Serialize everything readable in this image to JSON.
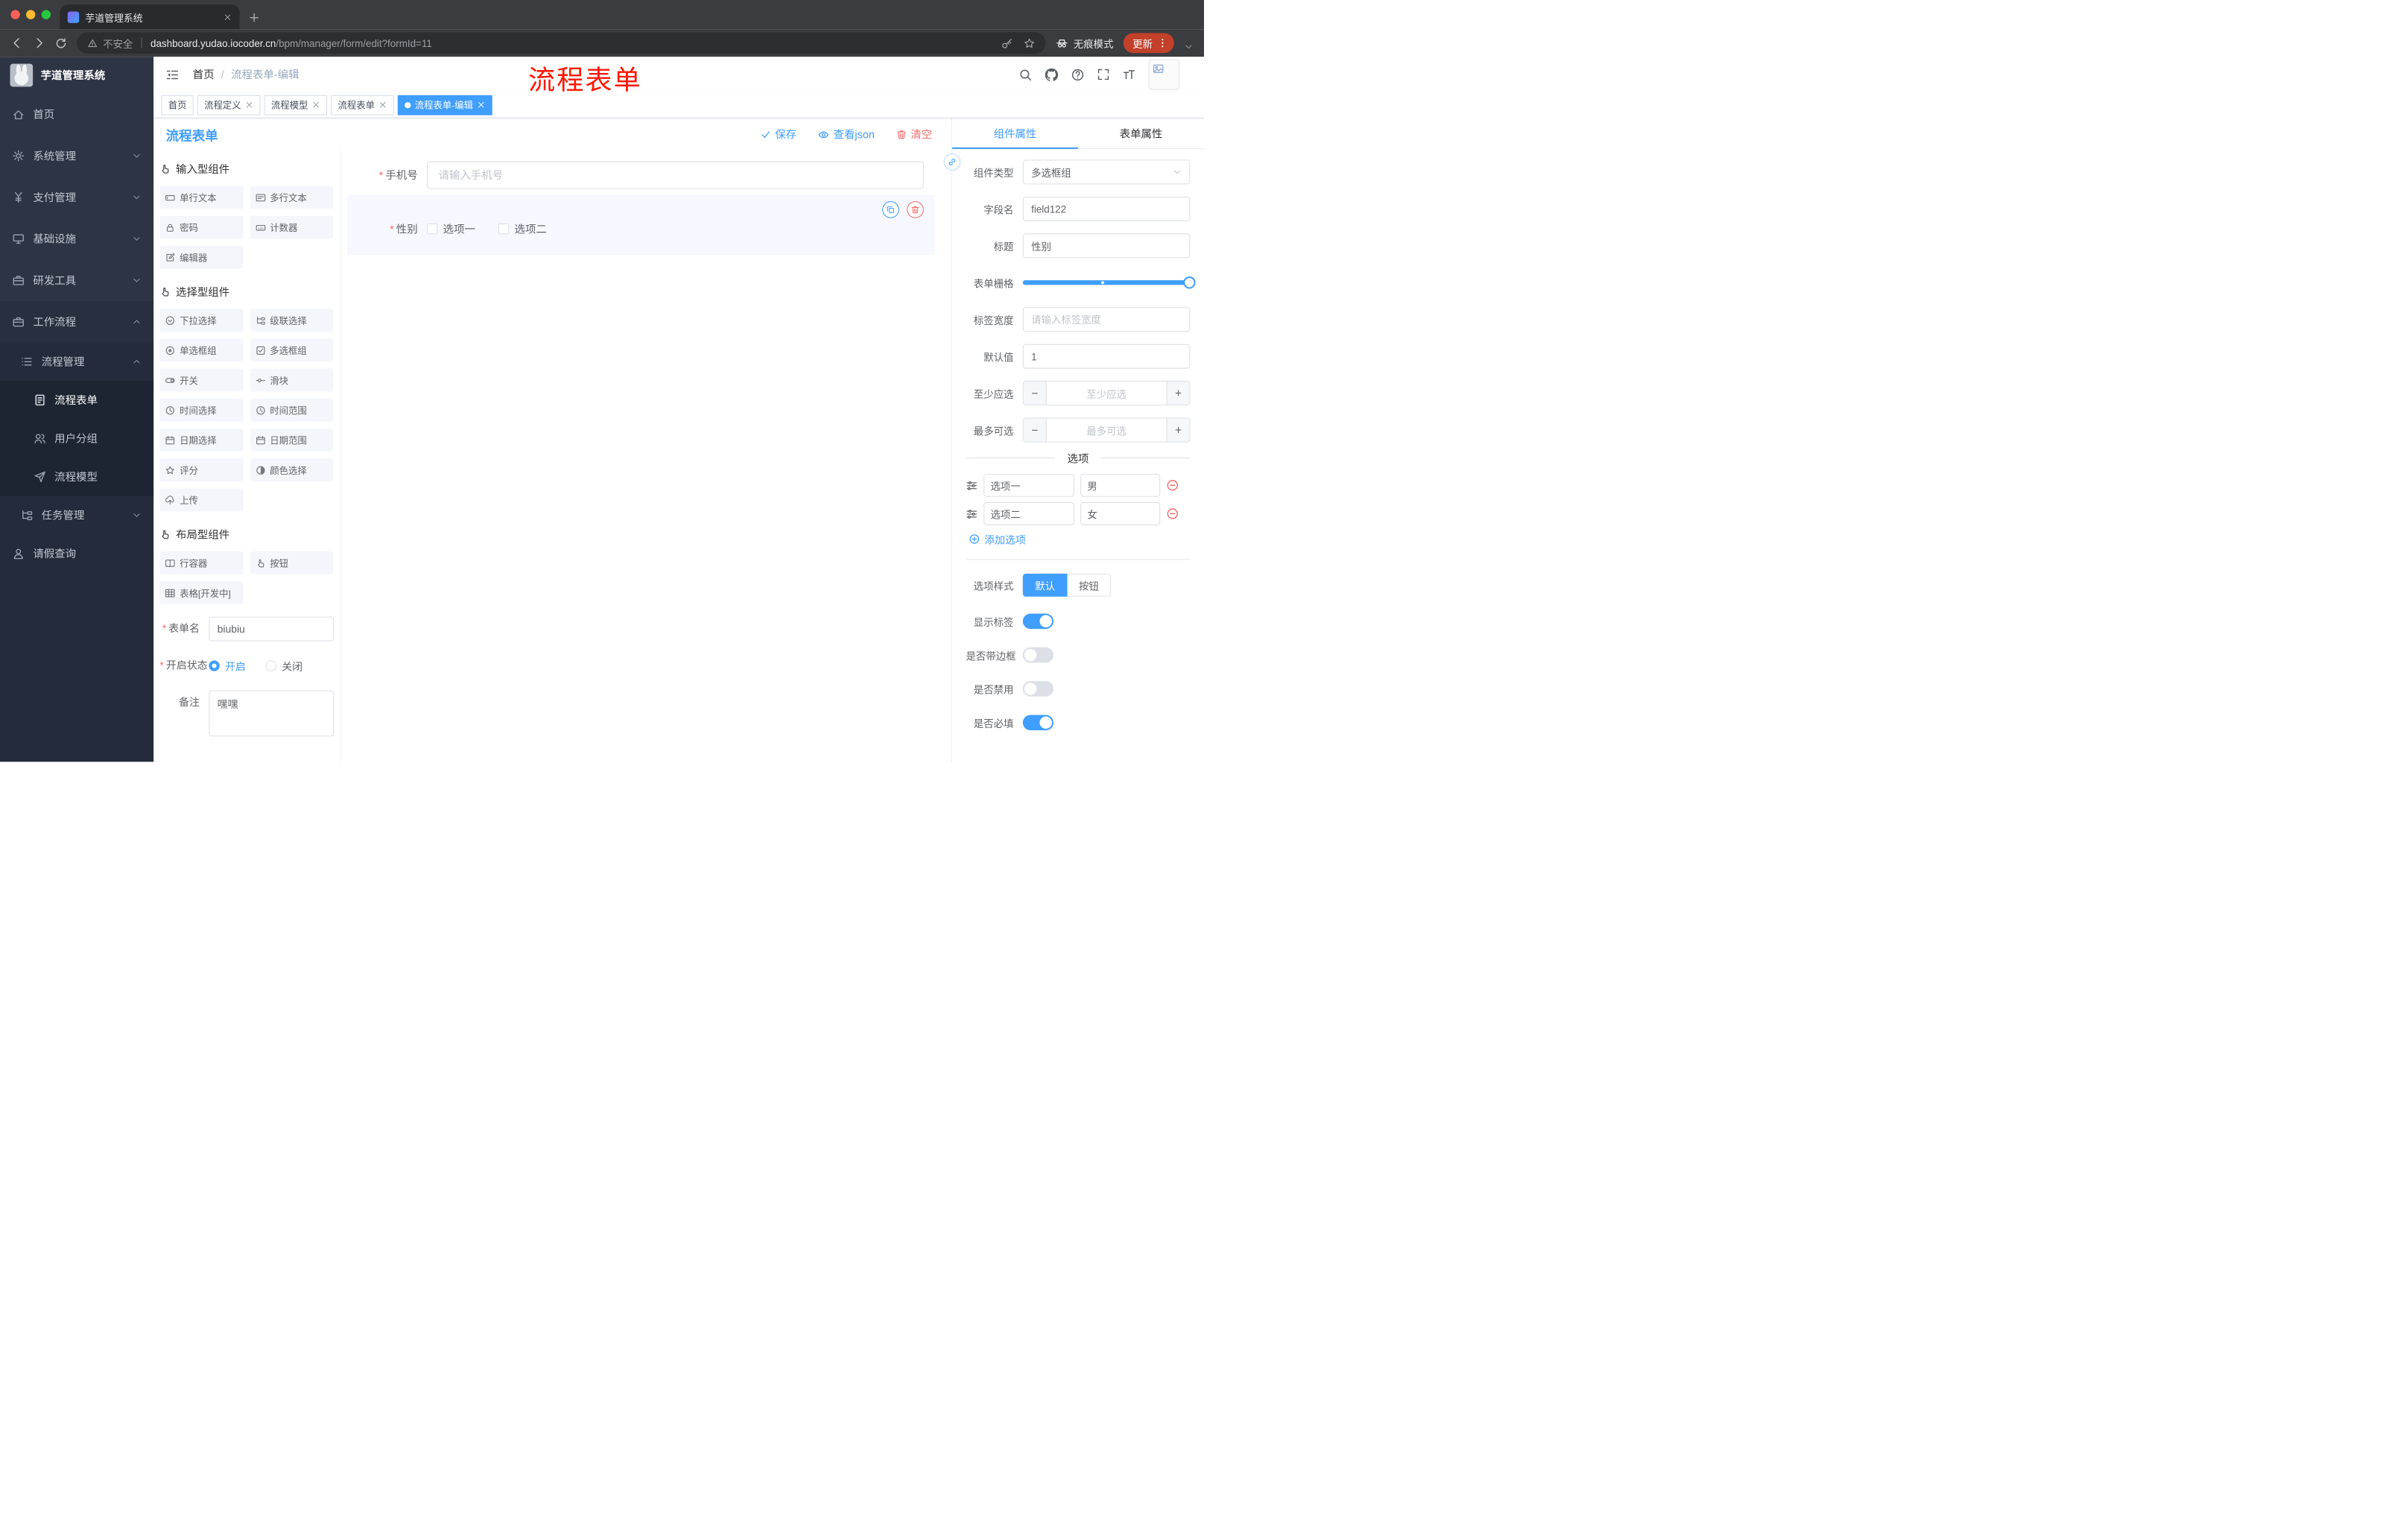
{
  "colors": {
    "primary": "#409EFF",
    "danger": "#F56C6C",
    "annotation_red": "#FF1500",
    "sidebar_bg": "#2D3444",
    "active_tag": "#409EFF",
    "traffic_lights": [
      "#FF5F57",
      "#FEBC2E",
      "#28C840"
    ]
  },
  "browser": {
    "tab_title": "芋道管理系统",
    "security_label": "不安全",
    "url_host": "dashboard.yudao.iocoder.cn",
    "url_path": "/bpm/manager/form/edit?formId=11",
    "incognito_label": "无痕模式",
    "update_label": "更新"
  },
  "sidebar": {
    "logo_title": "芋道管理系统",
    "items": [
      {
        "label": "首页"
      },
      {
        "label": "系统管理",
        "expanded": false
      },
      {
        "label": "支付管理",
        "expanded": false
      },
      {
        "label": "基础设施",
        "expanded": false
      },
      {
        "label": "研发工具",
        "expanded": false
      },
      {
        "label": "工作流程",
        "expanded": true
      },
      {
        "label": "流程管理",
        "level": 2,
        "expanded": true
      },
      {
        "label": "流程表单",
        "level": 3,
        "active": true
      },
      {
        "label": "用户分组",
        "level": 3
      },
      {
        "label": "流程模型",
        "level": 3
      },
      {
        "label": "任务管理",
        "level": 2,
        "expanded": false
      },
      {
        "label": "请假查询"
      }
    ]
  },
  "navbar": {
    "breadcrumb": {
      "root": "首页",
      "separator": "/",
      "current": "流程表单-编辑"
    },
    "annotation": "流程表单"
  },
  "tags": [
    {
      "label": "首页",
      "closable": false,
      "active": false
    },
    {
      "label": "流程定义",
      "closable": true,
      "active": false
    },
    {
      "label": "流程模型",
      "closable": true,
      "active": false
    },
    {
      "label": "流程表单",
      "closable": true,
      "active": false
    },
    {
      "label": "流程表单-编辑",
      "closable": true,
      "active": true
    }
  ],
  "editor": {
    "title": "流程表单",
    "actions": {
      "save": "保存",
      "view_json": "查看json",
      "clear": "清空"
    },
    "palette": {
      "sections": [
        {
          "title": "输入型组件",
          "items": [
            "单行文本",
            "多行文本",
            "密码",
            "计数器",
            "编辑器"
          ]
        },
        {
          "title": "选择型组件",
          "items": [
            "下拉选择",
            "级联选择",
            "单选框组",
            "多选框组",
            "开关",
            "滑块",
            "时间选择",
            "时间范围",
            "日期选择",
            "日期范围",
            "评分",
            "颜色选择",
            "上传"
          ]
        },
        {
          "title": "布局型组件",
          "items": [
            "行容器",
            "按钮",
            "表格[开发中]"
          ]
        }
      ]
    },
    "meta": {
      "form_name": {
        "label": "表单名",
        "value": "biubiu",
        "required": true
      },
      "status": {
        "label": "开启状态",
        "required": true,
        "options": [
          {
            "label": "开启",
            "selected": true
          },
          {
            "label": "关闭",
            "selected": false
          }
        ]
      },
      "remark": {
        "label": "备注",
        "value": "嘿嘿"
      }
    },
    "canvas": {
      "phone": {
        "label": "手机号",
        "placeholder": "请输入手机号",
        "required": true,
        "value": ""
      },
      "gender": {
        "label": "性别",
        "required": true,
        "options": [
          {
            "label": "选项一",
            "checked": false
          },
          {
            "label": "选项二",
            "checked": false
          }
        ]
      }
    }
  },
  "properties": {
    "tabs": [
      {
        "label": "组件属性",
        "active": true
      },
      {
        "label": "表单属性",
        "active": false
      }
    ],
    "component_type": {
      "label": "组件类型",
      "value": "多选框组"
    },
    "field_name": {
      "label": "字段名",
      "value": "field122"
    },
    "title": {
      "label": "标题",
      "value": "性别"
    },
    "grid": {
      "label": "表单栅格",
      "value": 24,
      "max": 24
    },
    "label_width": {
      "label": "标签宽度",
      "placeholder": "请输入标签宽度",
      "value": ""
    },
    "default_value": {
      "label": "默认值",
      "value": "1"
    },
    "min_select": {
      "label": "至少应选",
      "placeholder": "至少应选",
      "value": ""
    },
    "max_select": {
      "label": "最多可选",
      "placeholder": "最多可选",
      "value": ""
    },
    "options": {
      "divider_title": "选项",
      "rows": [
        {
          "label": "选项一",
          "value": "男"
        },
        {
          "label": "选项二",
          "value": "女"
        }
      ],
      "add_label": "添加选项"
    },
    "option_style": {
      "label": "选项样式",
      "choices": [
        {
          "label": "默认",
          "active": true
        },
        {
          "label": "按钮",
          "active": false
        }
      ]
    },
    "switches": [
      {
        "label": "显示标签",
        "on": true
      },
      {
        "label": "是否带边框",
        "on": false
      },
      {
        "label": "是否禁用",
        "on": false
      },
      {
        "label": "是否必填",
        "on": true
      }
    ]
  },
  "icons": {
    "browser": [
      "back-icon",
      "forward-icon",
      "reload-icon",
      "warning-icon",
      "key-icon",
      "star-icon",
      "incognito-icon",
      "kebab-menu-icon",
      "close-icon",
      "plus-icon"
    ],
    "navbar": [
      "menu-fold-icon",
      "search-icon",
      "github-icon",
      "help-icon",
      "fullscreen-icon",
      "font-size-icon",
      "avatar-image-icon"
    ],
    "editor": [
      "check-icon",
      "eye-icon",
      "trash-icon",
      "copy-icon",
      "drag-icon",
      "minus-circle-icon",
      "plus-circle-icon",
      "link-icon"
    ]
  }
}
